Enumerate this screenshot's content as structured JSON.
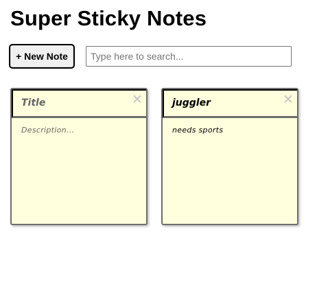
{
  "header": {
    "title": "Super Sticky Notes"
  },
  "toolbar": {
    "new_note_label": "+ New Note",
    "search_placeholder": "Type here to search...",
    "search_value": ""
  },
  "notes": [
    {
      "title": "Title",
      "title_is_placeholder": true,
      "description": "Description...",
      "description_is_placeholder": true,
      "close_glyph": "✕"
    },
    {
      "title": "juggler",
      "title_is_placeholder": false,
      "description": "needs sports",
      "description_is_placeholder": false,
      "close_glyph": "✕"
    }
  ],
  "colors": {
    "note_background": "#ffffdd",
    "note_border": "#6e6e6e",
    "close_icon": "#c4c4c4"
  },
  "icons": {
    "note_close": "close-icon"
  }
}
